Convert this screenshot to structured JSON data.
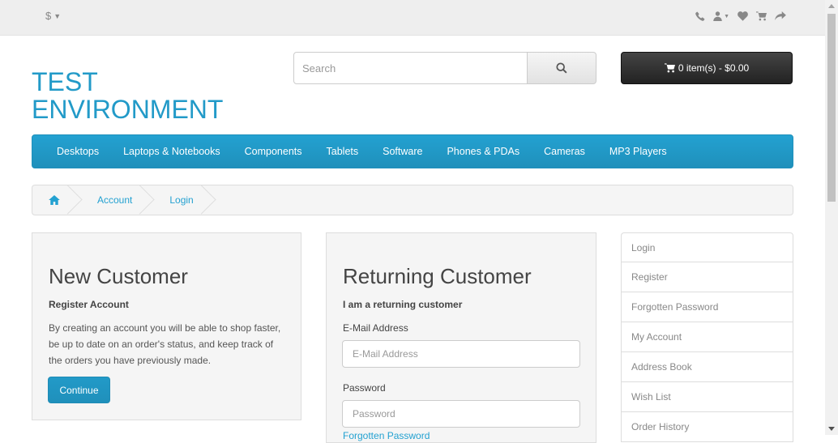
{
  "topbar": {
    "currency_symbol": "$",
    "icons": [
      "phone-icon",
      "user-icon",
      "heart-icon",
      "shopping-cart-icon",
      "share-icon"
    ]
  },
  "header": {
    "logo_line1": "TEST",
    "logo_line2": "ENVIRONMENT",
    "search_placeholder": "Search",
    "search_button_icon": "search-icon",
    "cart_label": "0 item(s) - $0.00"
  },
  "nav": {
    "items": [
      "Desktops",
      "Laptops & Notebooks",
      "Components",
      "Tablets",
      "Software",
      "Phones & PDAs",
      "Cameras",
      "MP3 Players"
    ]
  },
  "breadcrumb": {
    "home_icon": "home-icon",
    "items": [
      "Account",
      "Login"
    ]
  },
  "new_customer": {
    "title": "New Customer",
    "subtitle": "Register Account",
    "description": "By creating an account you will be able to shop faster, be up to date on an order's status, and keep track of the orders you have previously made.",
    "button": "Continue"
  },
  "returning_customer": {
    "title": "Returning Customer",
    "subtitle": "I am a returning customer",
    "email_label": "E-Mail Address",
    "email_placeholder": "E-Mail Address",
    "password_label": "Password",
    "password_placeholder": "Password",
    "forgotten_link": "Forgotten Password"
  },
  "sidebar": {
    "items": [
      "Login",
      "Register",
      "Forgotten Password",
      "My Account",
      "Address Book",
      "Wish List",
      "Order History"
    ]
  },
  "colors": {
    "accent": "#229ac8",
    "cart_bg": "#333333",
    "panel_bg": "#f5f5f5"
  }
}
